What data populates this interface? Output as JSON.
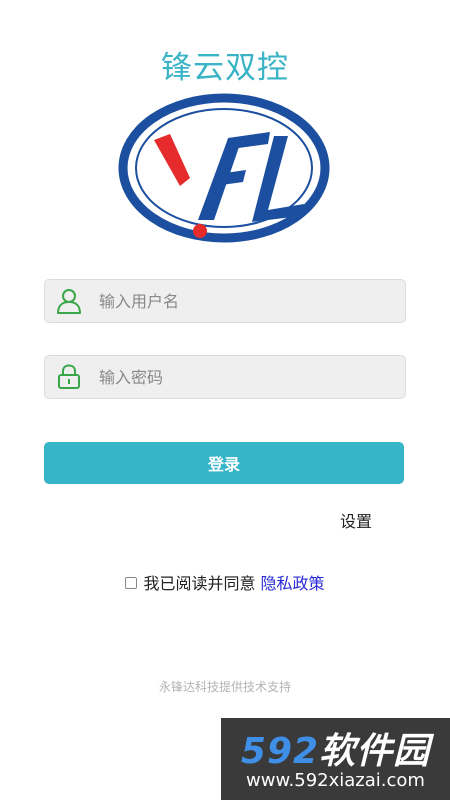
{
  "header": {
    "title": "锋云双控",
    "logo_icon": "yfl-logo-icon"
  },
  "form": {
    "username": {
      "placeholder": "输入用户名",
      "value": "",
      "icon": "user-icon"
    },
    "password": {
      "placeholder": "输入密码",
      "value": "",
      "icon": "lock-icon"
    },
    "login_label": "登录",
    "settings_label": "设置"
  },
  "agreement": {
    "text": "我已阅读并同意",
    "link_label": "隐私政策",
    "checked": false
  },
  "footer": {
    "text": "永锋达科技提供技术支持"
  },
  "watermark": {
    "number": "592",
    "name": "软件园",
    "url": "www.592xiazai.com"
  },
  "colors": {
    "accent": "#36b4c8",
    "logo_blue": "#1c4fa0",
    "logo_red": "#e52b2b",
    "icon_green": "#3aa64a",
    "link": "#2a2ad8"
  }
}
